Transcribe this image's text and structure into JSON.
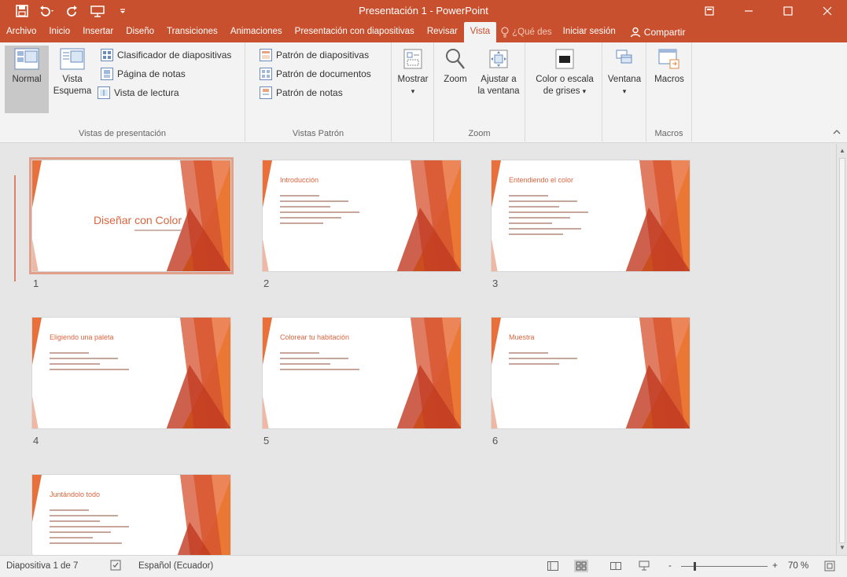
{
  "window": {
    "title": "Presentación 1 - PowerPoint"
  },
  "tabs": [
    {
      "label": "Archivo"
    },
    {
      "label": "Inicio"
    },
    {
      "label": "Insertar"
    },
    {
      "label": "Diseño"
    },
    {
      "label": "Transiciones"
    },
    {
      "label": "Animaciones"
    },
    {
      "label": "Presentación con diapositivas"
    },
    {
      "label": "Revisar"
    },
    {
      "label": "Vista",
      "active": true
    }
  ],
  "tell_me": "¿Qué des",
  "sign_in": "Iniciar sesión",
  "share": "Compartir",
  "ribbon": {
    "vistas_presentacion": {
      "label": "Vistas de presentación",
      "normal": "Normal",
      "vista_esquema_1": "Vista",
      "vista_esquema_2": "Esquema",
      "clasificador": "Clasificador de diapositivas",
      "pagina_notas": "Página de notas",
      "vista_lectura": "Vista de lectura"
    },
    "vistas_patron": {
      "label": "Vistas Patrón",
      "patron_diapositivas": "Patrón de diapositivas",
      "patron_documentos": "Patrón de documentos",
      "patron_notas": "Patrón de notas"
    },
    "mostrar": "Mostrar",
    "zoom": {
      "label": "Zoom",
      "zoom": "Zoom",
      "ajustar_1": "Ajustar a",
      "ajustar_2": "la ventana"
    },
    "color": {
      "line1": "Color o escala",
      "line2": "de grises"
    },
    "ventana": "Ventana",
    "macros": {
      "label": "Macros",
      "button": "Macros"
    }
  },
  "slides": [
    {
      "number": "1",
      "title": "Diseñar con Color",
      "cover": true,
      "selected": true,
      "bullet_lines": 0
    },
    {
      "number": "2",
      "title": "Introducción",
      "bullet_lines": 6
    },
    {
      "number": "3",
      "title": "Entendiendo el color",
      "bullet_lines": 8
    },
    {
      "number": "4",
      "title": "Eligiendo una paleta",
      "bullet_lines": 4
    },
    {
      "number": "5",
      "title": "Colorear tu habitación",
      "bullet_lines": 4
    },
    {
      "number": "6",
      "title": "Muestra",
      "bullet_lines": 3
    },
    {
      "number": "7",
      "title": "Juntándolo todo",
      "bullet_lines": 7
    }
  ],
  "status": {
    "slide_info": "Diapositiva 1 de 7",
    "language": "Español (Ecuador)",
    "zoom_minus": "-",
    "zoom_plus": "+",
    "zoom_level": "70 %",
    "zoom_fraction": 0.15
  },
  "colors": {
    "accent": "#c8502e",
    "slide_title": "#d8653f"
  }
}
